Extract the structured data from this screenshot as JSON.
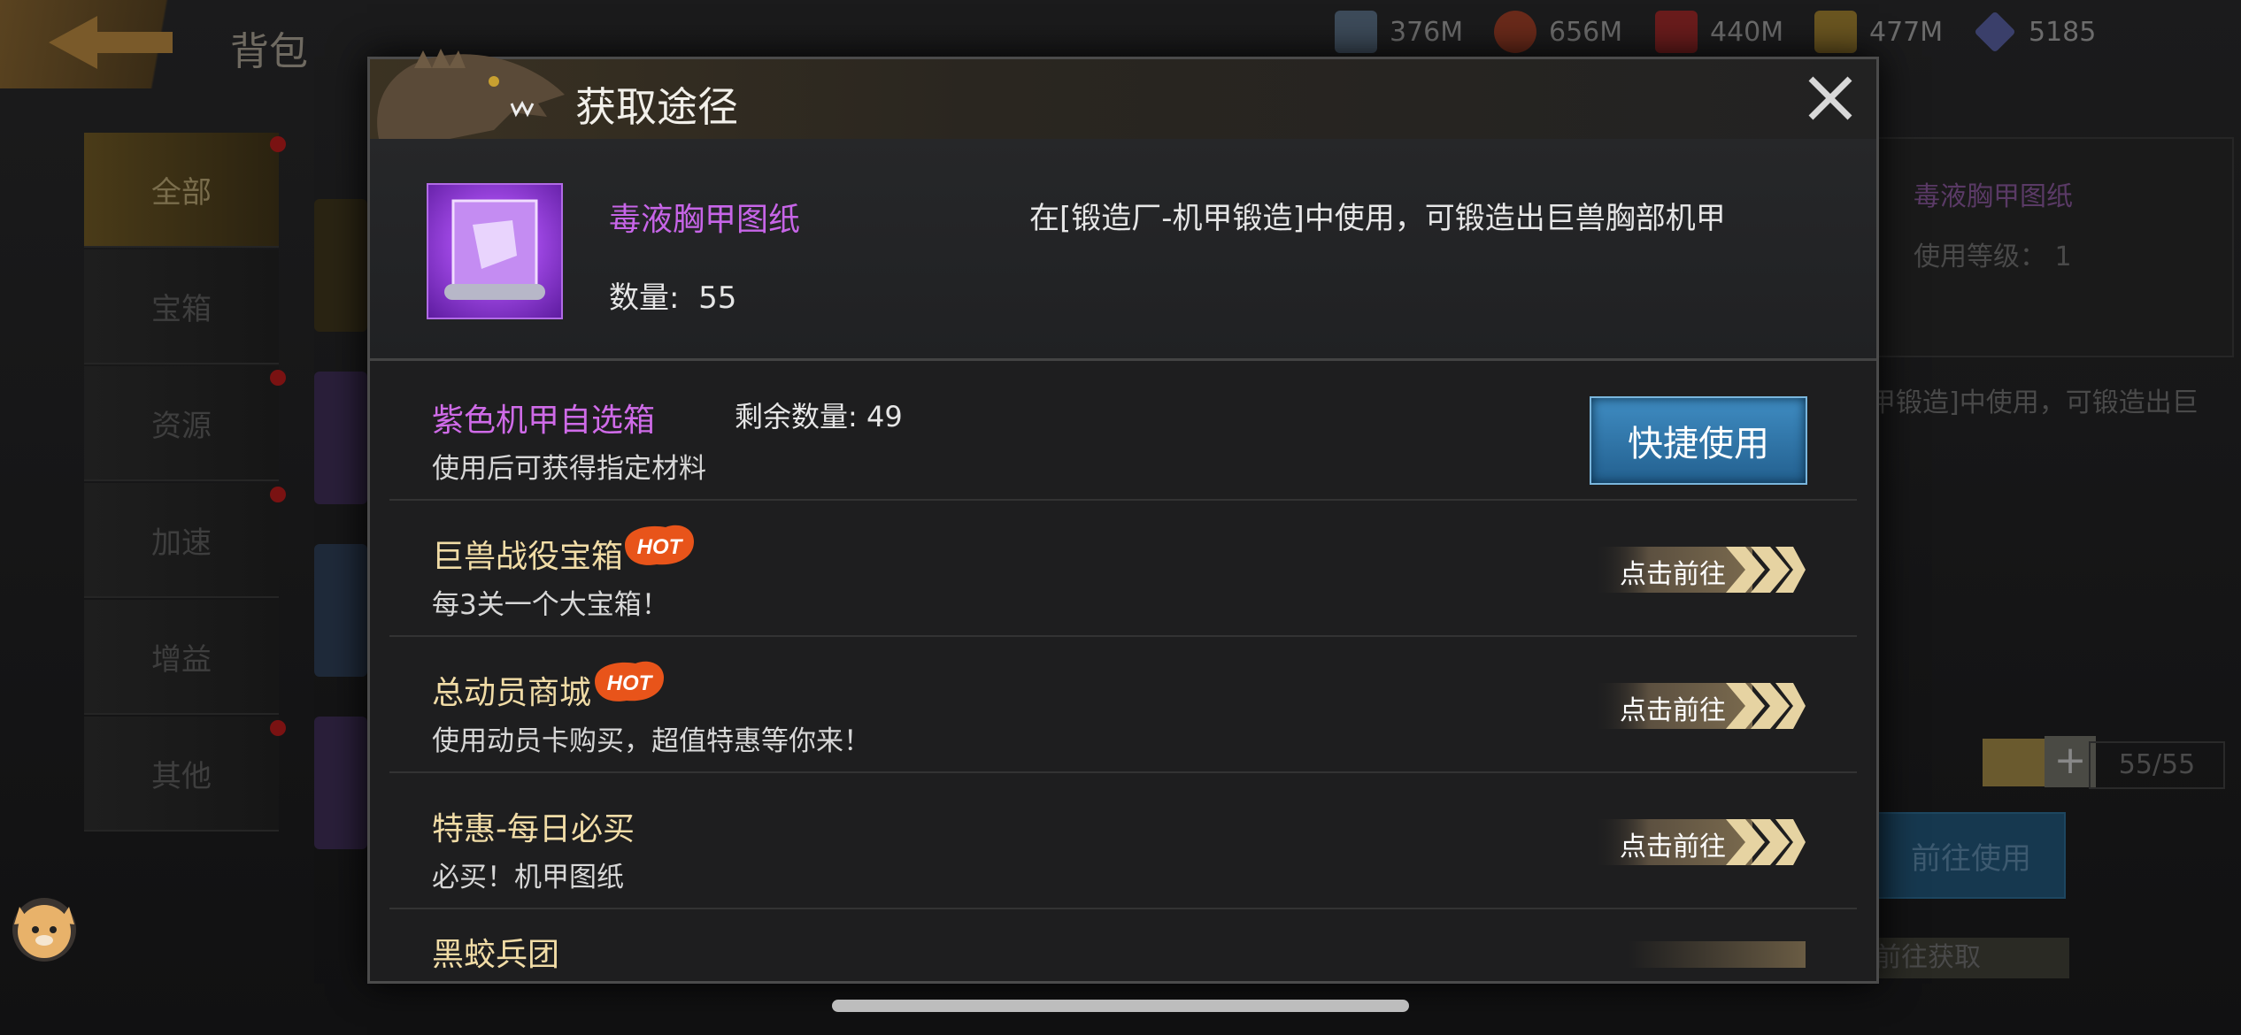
{
  "background": {
    "title": "背包",
    "resources": [
      {
        "icon": "steel-icon",
        "value": "376M"
      },
      {
        "icon": "food-icon",
        "value": "656M"
      },
      {
        "icon": "oil-icon",
        "value": "440M"
      },
      {
        "icon": "gold-bar-icon",
        "value": "477M"
      },
      {
        "icon": "diamond-icon",
        "value": "5185"
      }
    ],
    "tabs": [
      "全部",
      "宝箱",
      "资源",
      "加速",
      "增益",
      "其他"
    ],
    "detail_name": "毒液胸甲图纸",
    "detail_level_label": "使用等级：",
    "detail_level_value": "1",
    "detail_desc_partial": "甲锻造]中使用，可锻造出巨",
    "slider_count": "55/55",
    "use_button": "前往使用",
    "obtain_button": "前往获取"
  },
  "modal": {
    "title": "获取途径",
    "item": {
      "name": "毒液胸甲图纸",
      "description": "在[锻造厂-机甲锻造]中使用，可锻造出巨兽胸部机甲",
      "quantity_label": "数量:",
      "quantity": "55"
    },
    "sources": [
      {
        "title": "紫色机甲自选箱",
        "subtitle": "使用后可获得指定材料",
        "remaining_label": "剩余数量:",
        "remaining": "49",
        "button": "快捷使用"
      },
      {
        "title": "巨兽战役宝箱",
        "subtitle": "每3关一个大宝箱！",
        "hot": "HOT",
        "button": "点击前往"
      },
      {
        "title": "总动员商城",
        "subtitle": "使用动员卡购买，超值特惠等你来！",
        "hot": "HOT",
        "button": "点击前往"
      },
      {
        "title": "特惠-每日必买",
        "subtitle": "必买！机甲图纸",
        "button": "点击前往"
      },
      {
        "title": "黑蛟兵团",
        "button": ""
      }
    ]
  },
  "colors": {
    "accent_purple": "#c765e8",
    "gold_text": "#f1dca6",
    "blue_button": "#2f78ad"
  }
}
